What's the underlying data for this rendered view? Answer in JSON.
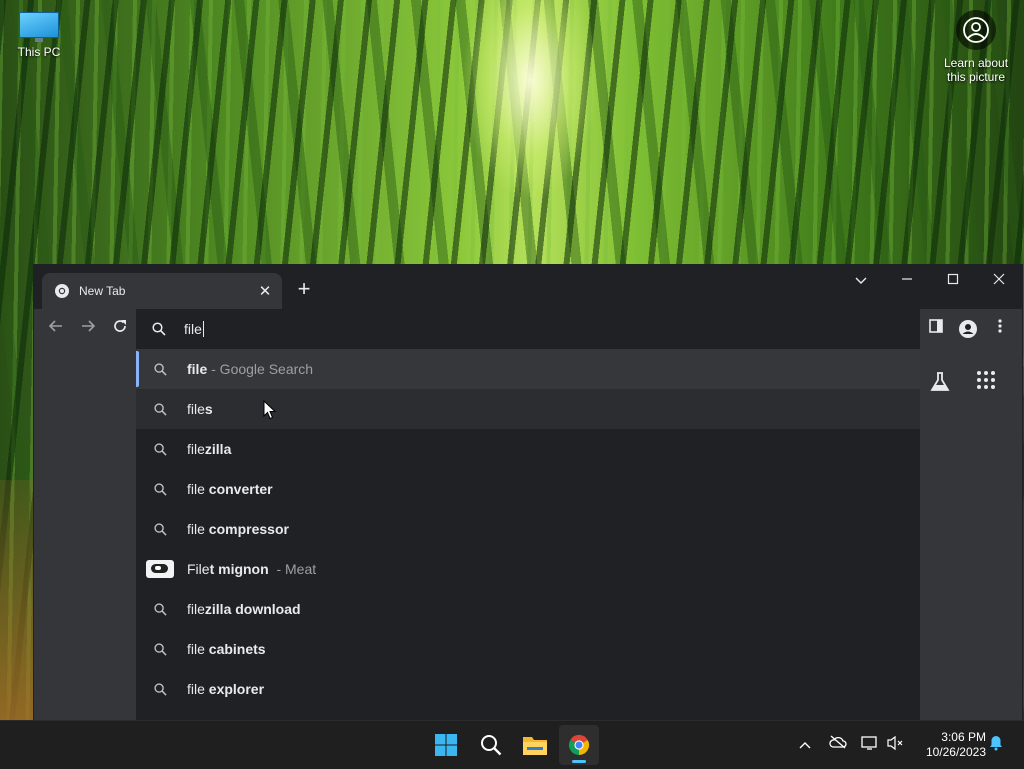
{
  "desktop": {
    "icons": [
      {
        "label": "This PC",
        "icon": "monitor-icon"
      }
    ],
    "spotlight": {
      "label_line1": "Learn about",
      "label_line2": "this picture",
      "icon": "camera-icon"
    }
  },
  "browser": {
    "tab": {
      "title": "New Tab",
      "icon": "chrome-icon"
    },
    "new_tab_icon": "plus-icon",
    "window_controls": [
      "chevron-down-icon",
      "minimize-icon",
      "maximize-icon",
      "close-icon"
    ],
    "nav": [
      "back-icon",
      "forward-icon",
      "reload-icon"
    ],
    "omnibox": {
      "value": "file"
    },
    "toolbar_icons": [
      "side-panel-icon",
      "profile-icon",
      "menu-icon"
    ],
    "page_icons": [
      "labs-icon",
      "apps-grid-icon"
    ],
    "suggestions": [
      {
        "typed": "file",
        "completion": "",
        "description": "- Google Search",
        "icon": "search-icon",
        "selected": true
      },
      {
        "typed": "file",
        "completion": "s",
        "description": "",
        "icon": "search-icon",
        "hovered": true
      },
      {
        "typed": "file",
        "completion": "zilla",
        "description": "",
        "icon": "search-icon"
      },
      {
        "typed": "file",
        "completion": " converter",
        "description": "",
        "icon": "search-icon"
      },
      {
        "typed": "file",
        "completion": " compressor",
        "description": "",
        "icon": "search-icon"
      },
      {
        "typed": "File",
        "completion": "t mignon",
        "description": "- Meat",
        "icon": "entity-thumbnail"
      },
      {
        "typed": "file",
        "completion": "zilla download",
        "description": "",
        "icon": "search-icon"
      },
      {
        "typed": "file",
        "completion": " cabinets",
        "description": "",
        "icon": "search-icon"
      },
      {
        "typed": "file",
        "completion": " explorer",
        "description": "",
        "icon": "search-icon"
      }
    ],
    "colors": {
      "selected_bar": "#8ab4f8",
      "dropdown_bg": "#202124",
      "frame_bg": "#35363a"
    }
  },
  "taskbar": {
    "apps": [
      "start-icon",
      "search-icon",
      "file-explorer-icon",
      "chrome-icon"
    ],
    "tray": [
      "chevron-up-icon",
      "onedrive-offline-icon",
      "network-icon",
      "volume-muted-icon",
      "notification-bell-icon"
    ],
    "clock": {
      "time": "3:06 PM",
      "date": "10/26/2023"
    }
  }
}
